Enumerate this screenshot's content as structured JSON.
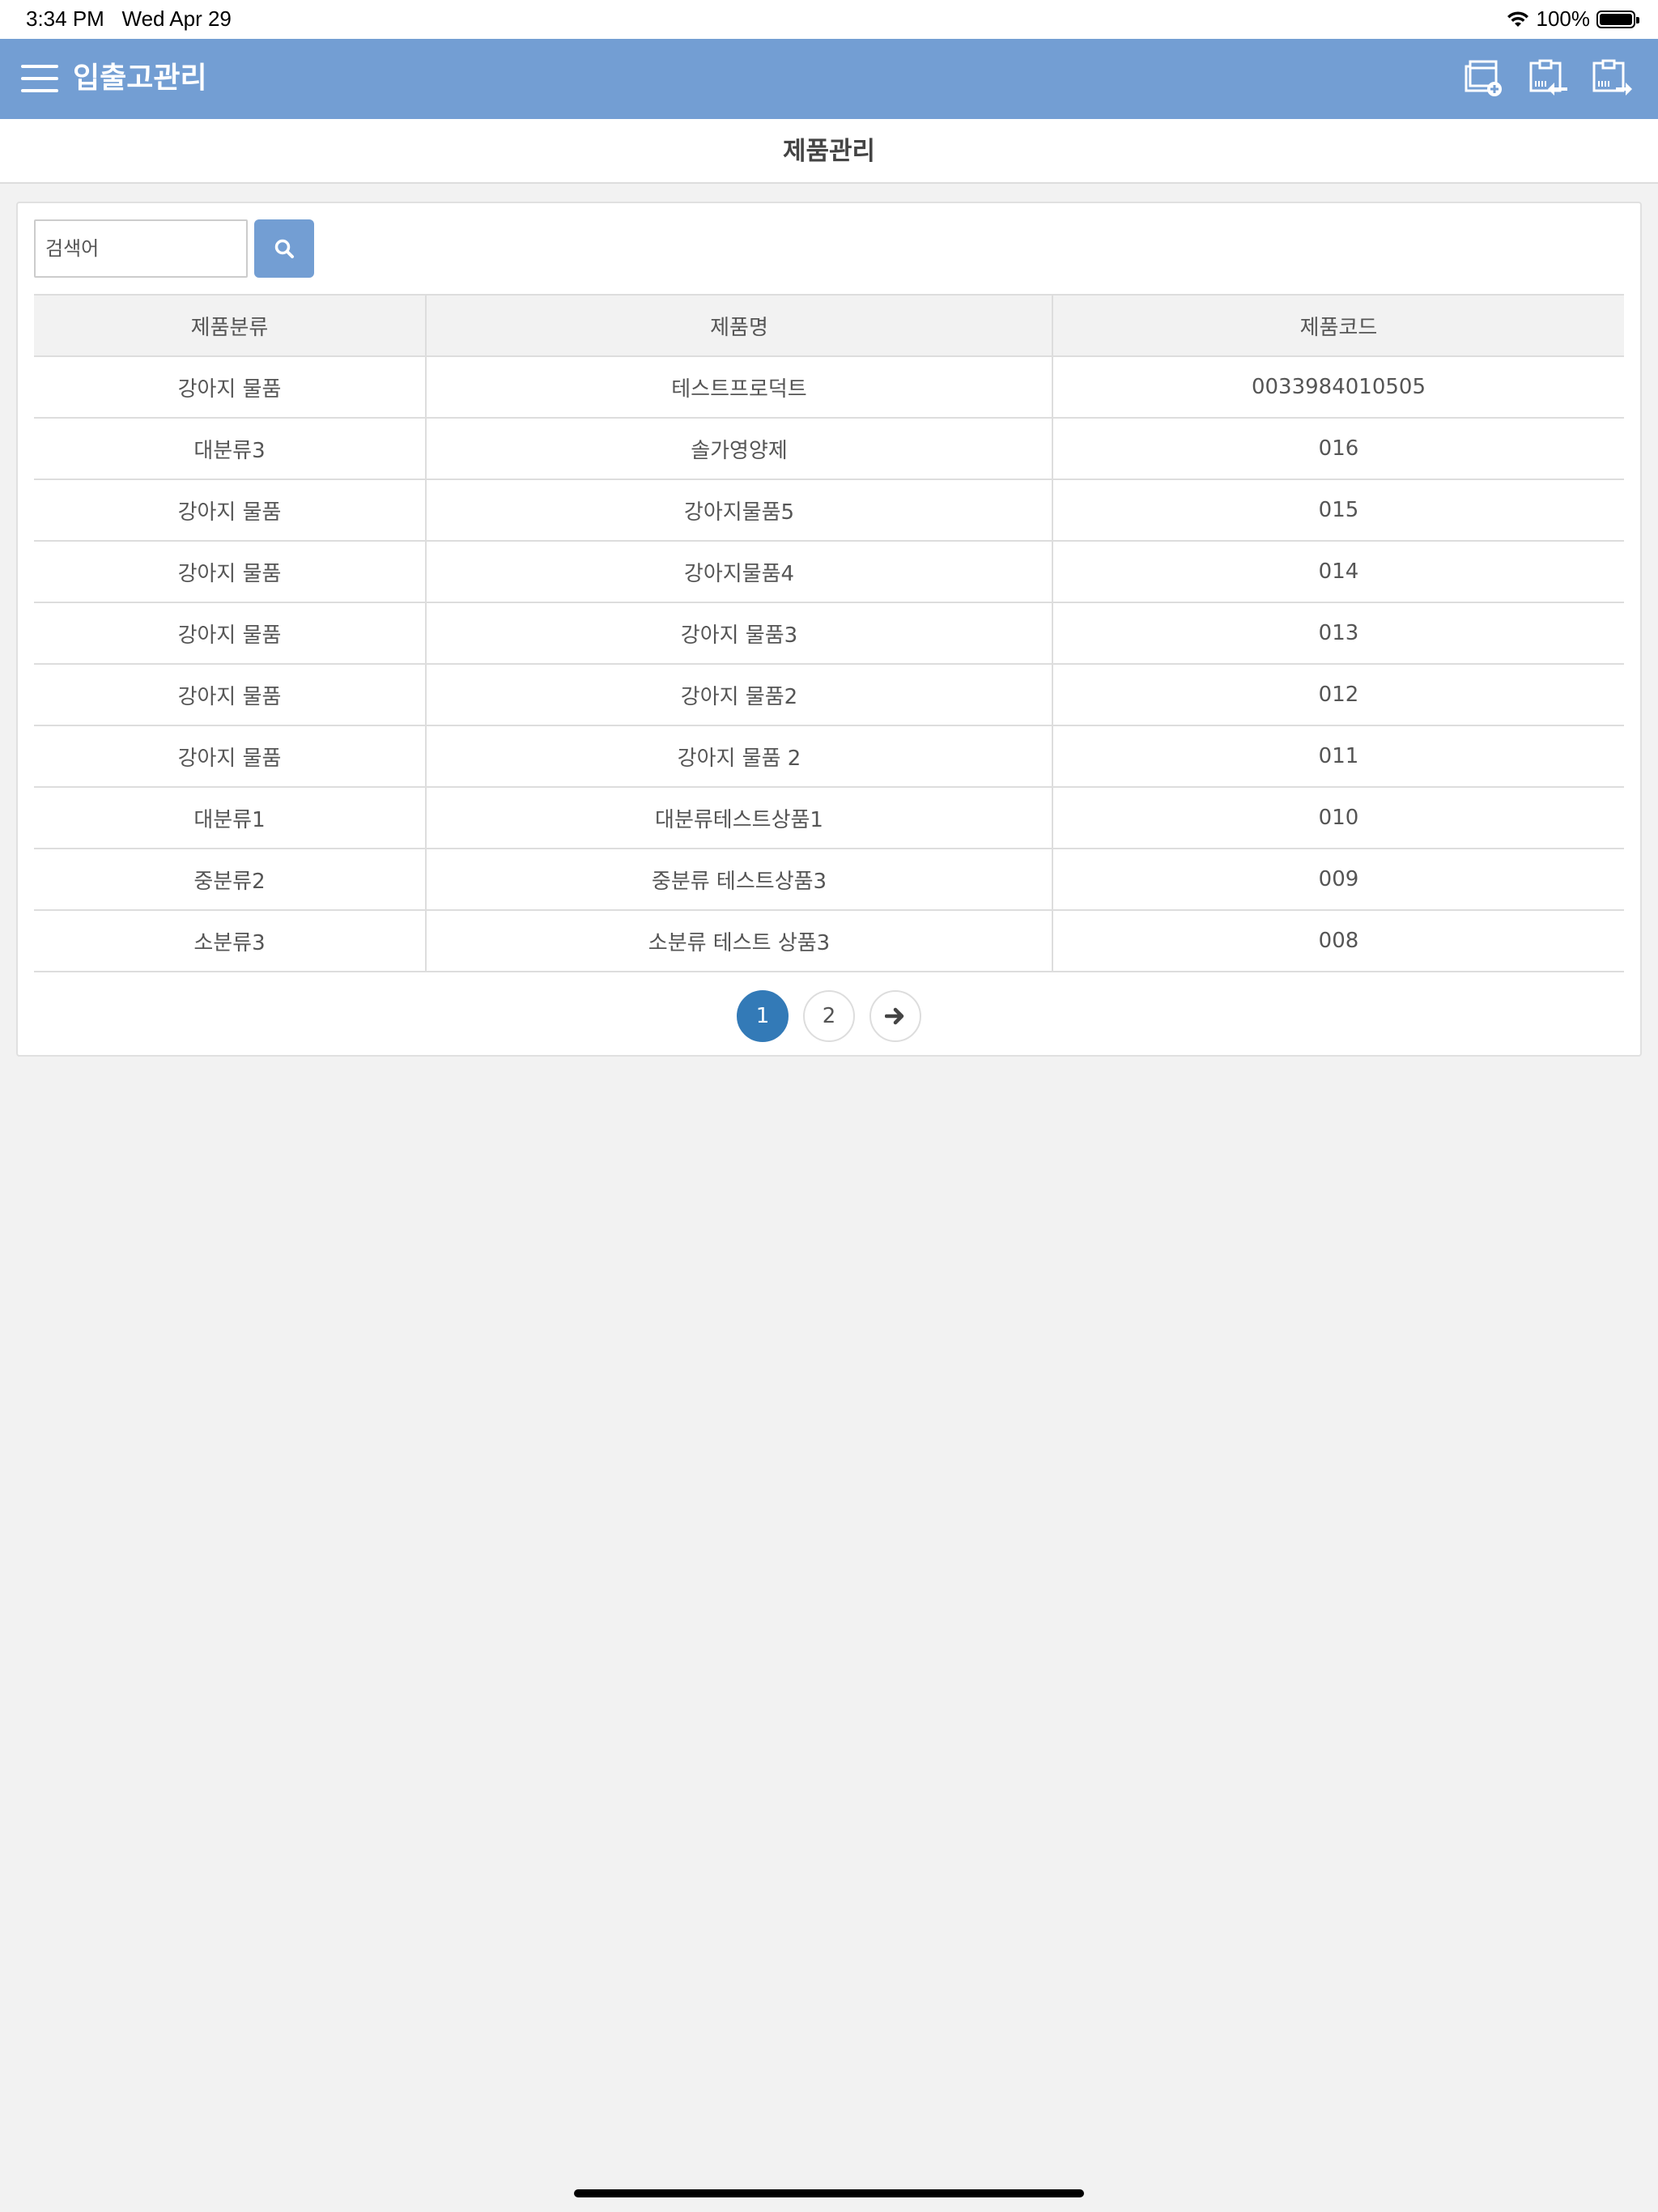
{
  "status_bar": {
    "time": "3:34 PM",
    "date": "Wed Apr 29",
    "battery": "100%",
    "battery_level": 1.0
  },
  "app_bar": {
    "title": "입출고관리",
    "background": "#739ed3",
    "actions": [
      "add-product-icon",
      "stock-in-icon",
      "stock-out-icon"
    ]
  },
  "subheader": {
    "title": "제품관리"
  },
  "search": {
    "placeholder": "검색어",
    "button_icon": "search-icon",
    "button_color": "#739ed3"
  },
  "table": {
    "headers": [
      "제품분류",
      "제품명",
      "제품코드"
    ],
    "rows": [
      [
        "강아지 물품",
        "테스트프로덕트",
        "0033984010505"
      ],
      [
        "대분류3",
        "솔가영양제",
        "016"
      ],
      [
        "강아지 물품",
        "강아지물품5",
        "015"
      ],
      [
        "강아지 물품",
        "강아지물품4",
        "014"
      ],
      [
        "강아지 물품",
        "강아지 물품3",
        "013"
      ],
      [
        "강아지 물품",
        "강아지 물품2",
        "012"
      ],
      [
        "강아지 물품",
        "강아지 물품 2",
        "011"
      ],
      [
        "대분류1",
        "대분류테스트상품1",
        "010"
      ],
      [
        "중분류2",
        "중분류 테스트상품3",
        "009"
      ],
      [
        "소분류3",
        "소분류 테스트 상품3",
        "008"
      ]
    ]
  },
  "pagination": {
    "pages": [
      "1",
      "2"
    ],
    "current": "1",
    "next_icon": "arrow-right-icon",
    "active_color": "#337ab7"
  }
}
